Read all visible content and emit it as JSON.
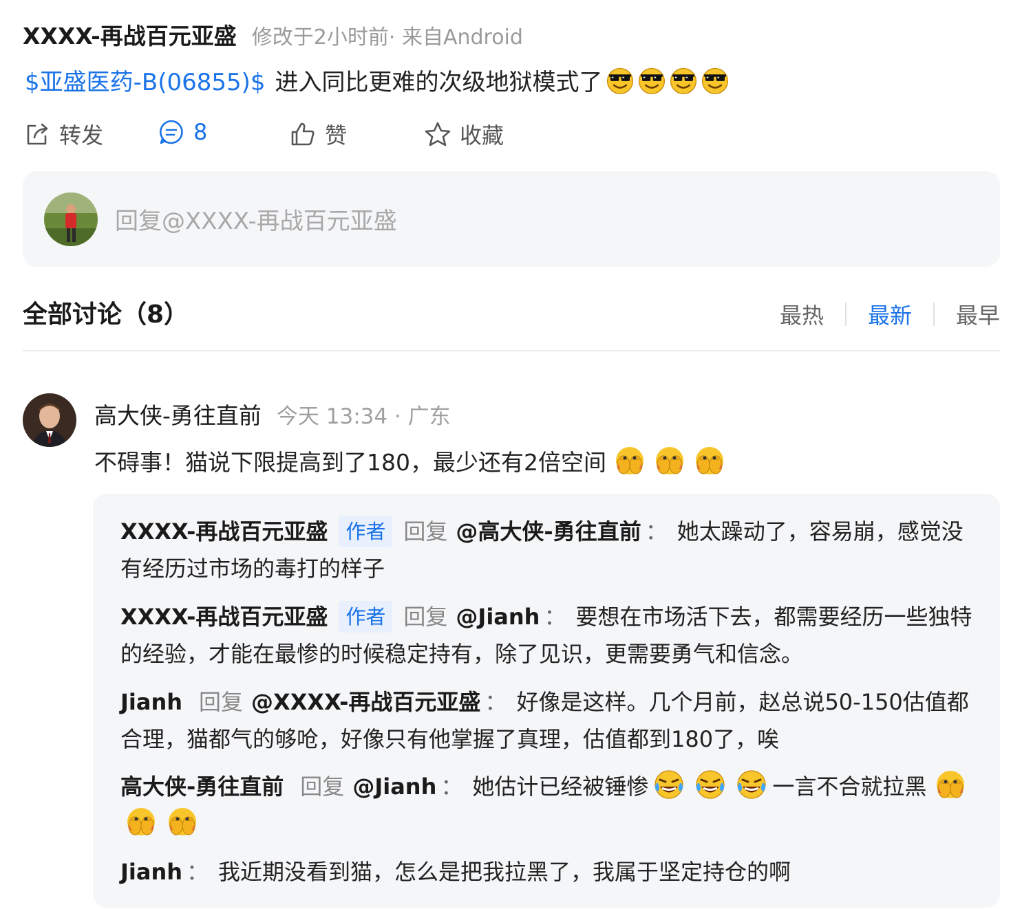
{
  "post": {
    "author": "XXXX-再战百元亚盛",
    "meta": "修改于2小时前· 来自Android",
    "stock": "$亚盛医药-B(06855)$",
    "text": "进入同比更难的次级地狱模式了"
  },
  "actions": {
    "forward": "转发",
    "comment_count": "8",
    "like": "赞",
    "favorite": "收藏"
  },
  "reply_box": {
    "placeholder": "回复@XXXX-再战百元亚盛"
  },
  "discussion": {
    "title": "全部讨论（8）",
    "sort_options": [
      "最热",
      "最新",
      "最早"
    ],
    "active_sort": "最新"
  },
  "comment": {
    "name": "高大侠-勇往直前",
    "meta": "今天 13:34 · 广东",
    "text": "不碍事！猫说下限提高到了180，最少还有2倍空间"
  },
  "replies": [
    {
      "name": "XXXX-再战百元亚盛",
      "tag": "作者",
      "reply_word": "回复",
      "target": "@高大侠-勇往直前",
      "colon": "：",
      "text": "她太躁动了，容易崩，感觉没有经历过市场的毒打的样子"
    },
    {
      "name": "XXXX-再战百元亚盛",
      "tag": "作者",
      "reply_word": "回复",
      "target": "@Jianh",
      "colon": "：",
      "text": "要想在市场活下去，都需要经历一些独特的经验，才能在最惨的时候稳定持有，除了见识，更需要勇气和信念。"
    },
    {
      "name": "Jianh",
      "reply_word": "回复",
      "target": "@XXXX-再战百元亚盛",
      "colon": "：",
      "text": "好像是这样。几个月前，赵总说50-150估值都合理，猫都气的够呛，好像只有他掌握了真理，估值都到180了，唉"
    },
    {
      "name": "高大侠-勇往直前",
      "reply_word": "回复",
      "target": "@Jianh",
      "colon": "：",
      "text_a": "她估计已经被锤惨",
      "text_b": "一言不合就拉黑"
    },
    {
      "name": "Jianh",
      "colon": "：",
      "text": "我近期没看到猫，怎么是把我拉黑了，我属于坚定持仓的啊"
    }
  ],
  "colors": {
    "accent": "#1a73e8",
    "panel_bg": "#f5f6f8",
    "muted": "#9a9a9a"
  },
  "icons": [
    "share-icon",
    "comment-icon",
    "thumbs-up-icon",
    "star-icon",
    "cool-sunglasses-emoji",
    "peeking-hands-emoji",
    "laughing-crying-emoji"
  ]
}
